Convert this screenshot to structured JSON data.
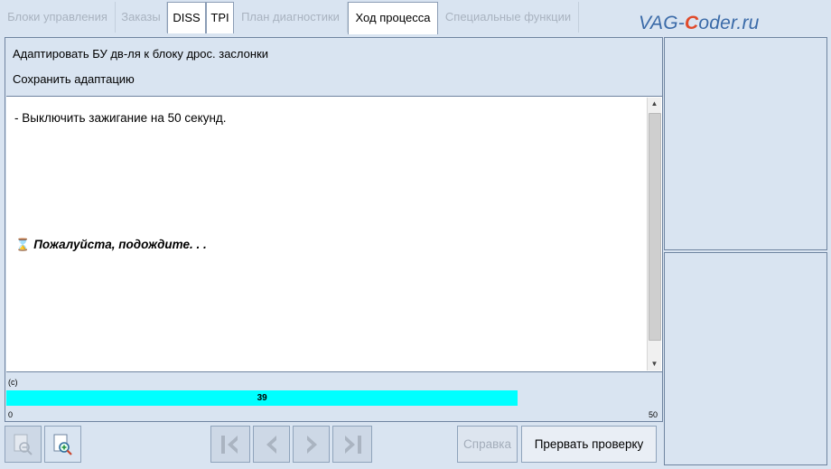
{
  "tabs": [
    {
      "label": "Блоки управления",
      "state": "disabled"
    },
    {
      "label": "Заказы",
      "state": "disabled"
    },
    {
      "label": "DISS",
      "state": "enabled"
    },
    {
      "label": "TPI",
      "state": "enabled"
    },
    {
      "label": "План диагностики",
      "state": "disabled"
    },
    {
      "label": "Ход процесса",
      "state": "active"
    },
    {
      "label": "Специальные функции",
      "state": "disabled"
    }
  ],
  "watermark": {
    "prefix": "VAG-",
    "accent": "C",
    "suffix": "oder.ru"
  },
  "process": {
    "title_line1": "Адаптировать БУ дв-ля к блоку дрос. заслонки",
    "title_line2": "Сохранить адаптацию",
    "instruction": "- Выключить зажигание на 50 секунд.",
    "wait_text": "Пожалуйста, подождите. . .",
    "wait_icon": "hourglass-icon"
  },
  "progress": {
    "unit_label": "(c)",
    "value": 39,
    "value_label": "39",
    "min_label": "0",
    "max_label": "50",
    "min": 0,
    "max": 50,
    "fill_color": "#00ffff"
  },
  "toolbar": {
    "zoom_out_icon": "zoom-out-icon",
    "zoom_in_icon": "zoom-in-icon",
    "first_icon": "skip-first-icon",
    "prev_icon": "prev-icon",
    "next_icon": "next-icon",
    "last_icon": "skip-last-icon",
    "help_label": "Справка",
    "abort_label": "Прервать проверку"
  },
  "colors": {
    "background": "#d9e4f1",
    "panel_border": "#6f84a0",
    "progress_fill": "#00ffff"
  }
}
